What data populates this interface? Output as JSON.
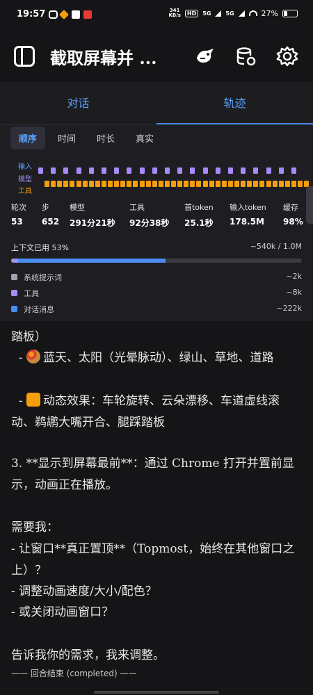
{
  "status_bar": {
    "time": "19:57",
    "net_speed_value": "341",
    "net_speed_unit": "KB/s",
    "hd": "HD",
    "sig1": "5G",
    "sig2": "5G",
    "battery": "27%"
  },
  "app_bar": {
    "title": "截取屏幕并 ...",
    "icons": [
      "sidebar-icon",
      "ai-assistant-icon",
      "database-settings-icon",
      "gear-icon"
    ]
  },
  "tabs": [
    {
      "label": "对话",
      "active": false
    },
    {
      "label": "轨迹",
      "active": true
    }
  ],
  "trace": {
    "subtabs": [
      {
        "label": "顺序",
        "active": true
      },
      {
        "label": "时间",
        "active": false
      },
      {
        "label": "时长",
        "active": false
      },
      {
        "label": "真实",
        "active": false
      }
    ],
    "lanes": {
      "input": "输入",
      "model": "模型",
      "tool": "工具"
    },
    "colors": {
      "input": "#5aa2ff",
      "model": "#a78bfa",
      "tool": "#f59e0b"
    },
    "stats": [
      {
        "label": "轮次",
        "value": "53"
      },
      {
        "label": "步",
        "value": "652"
      },
      {
        "label": "模型",
        "value": "291分21秒"
      },
      {
        "label": "工具",
        "value": "92分38秒"
      },
      {
        "label": "首token",
        "value": "25.1秒"
      },
      {
        "label": "输入token",
        "value": "178.5M"
      },
      {
        "label": "缓存",
        "value": "98%"
      }
    ],
    "context": {
      "label": "上下文已用 53%",
      "right": "~540k / 1.0M",
      "used_fraction": 0.53
    },
    "legend": [
      {
        "label": "系统提示词",
        "value": "~2k",
        "color": "#9ca3af"
      },
      {
        "label": "工具",
        "value": "~8k",
        "color": "#a78bfa"
      },
      {
        "label": "对话消息",
        "value": "~222k",
        "color": "#4b8df0"
      }
    ]
  },
  "chat": {
    "line_0": "踏板）",
    "line_1": "  - ",
    "line_1b": "蓝天、太阳（光晕脉动）、绿山、草地、道路",
    "line_2": "  - ",
    "line_2b": "动态效果：车轮旋转、云朵漂移、车道虚线滚动、鹈鹕大嘴开合、腿踩踏板",
    "line_3": "3. **显示到屏幕最前**：通过 Chrome 打开并置前显示，动画正在播放。",
    "line_4": "需要我：",
    "line_5": "- 让窗口**真正置顶**（Topmost，始终在其他窗口之上）？",
    "line_6": "- 调整动画速度/大小/配色？",
    "line_7": "- 或关闭动画窗口？",
    "line_8": "告诉我你的需求，我来调整。",
    "end_marker": "—— 回合结束 (completed) ——"
  }
}
